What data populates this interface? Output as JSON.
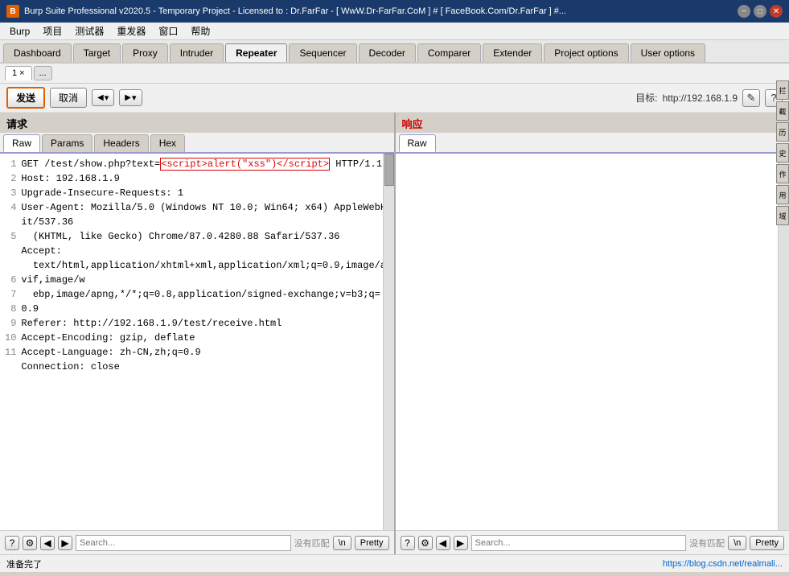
{
  "titlebar": {
    "icon": "B",
    "title": "Burp Suite Professional v2020.5 - Temporary Project - Licensed to : Dr.FarFar - [ WwW.Dr-FarFar.CoM ] # [ FaceBook.Com/Dr.FarFar ] #...",
    "minimize_label": "−",
    "maximize_label": "□",
    "close_label": "✕"
  },
  "menubar": {
    "items": [
      "Burp",
      "项目",
      "测试器",
      "重发器",
      "窗口",
      "帮助"
    ]
  },
  "top_tabs": {
    "items": [
      "Dashboard",
      "Target",
      "Proxy",
      "Intruder",
      "Repeater",
      "Sequencer",
      "Decoder",
      "Comparer",
      "Extender",
      "Project options",
      "User options"
    ],
    "active": "Repeater"
  },
  "sub_tabs": {
    "items": [
      "1"
    ],
    "active": "1",
    "more": "..."
  },
  "toolbar": {
    "send_label": "发送",
    "cancel_label": "取消",
    "nav_back": "< ▾",
    "nav_fwd": "> ▾",
    "target_label": "目标:",
    "target_url": "http://192.168.1.9",
    "edit_icon": "✎",
    "help_icon": "?"
  },
  "request": {
    "section_label": "请求",
    "tabs": [
      "Raw",
      "Params",
      "Headers",
      "Hex"
    ],
    "active_tab": "Raw",
    "lines": [
      {
        "num": 1,
        "text": "GET /test/show.php?text=",
        "highlight": "<script>alert(\"xss\")<\\/script>",
        "after": " HTTP/1.1"
      },
      {
        "num": 2,
        "text": "Host: 192.168.1.9"
      },
      {
        "num": 3,
        "text": "Upgrade-Insecure-Requests: 1"
      },
      {
        "num": 4,
        "text": "User-Agent: Mozilla/5.0 (Windows NT 10.0; Win64; x64) AppleWebKit/537.36",
        "continuation": "(KHTML, like Gecko) Chrome/87.0.4280.88 Safari/537.36"
      },
      {
        "num": 5,
        "text": "Accept:",
        "continuation": "text/html,application/xhtml+xml,application/xml;q=0.9,image/avif,image/w",
        "continuation2": "ebp,image/apng,*/*;q=0.8,application/signed-exchange;v=b3;q=0.9"
      },
      {
        "num": 6,
        "text": "Referer: http://192.168.1.9/test/receive.html"
      },
      {
        "num": 7,
        "text": "Accept-Encoding: gzip, deflate"
      },
      {
        "num": 8,
        "text": "Accept-Language: zh-CN,zh;q=0.9"
      },
      {
        "num": 9,
        "text": "Connection: close"
      },
      {
        "num": 10,
        "text": ""
      },
      {
        "num": 11,
        "text": ""
      }
    ],
    "bottom": {
      "search_placeholder": "Search...",
      "no_match": "没有匹配",
      "newline_btn": "\\n",
      "pretty_btn": "Pretty"
    }
  },
  "response": {
    "section_label": "响应",
    "tabs": [
      "Raw"
    ],
    "active_tab": "Raw",
    "content": "",
    "bottom": {
      "search_placeholder": "Search...",
      "no_match": "没有匹配",
      "newline_btn": "\\n",
      "pretty_btn": "Pretty"
    }
  },
  "statusbar": {
    "status": "准备完了",
    "link": "https://blog.csdn.net/realmali..."
  },
  "right_edge": {
    "buttons": [
      "拦",
      "截",
      "历",
      "史",
      "作",
      "用",
      "域"
    ]
  }
}
